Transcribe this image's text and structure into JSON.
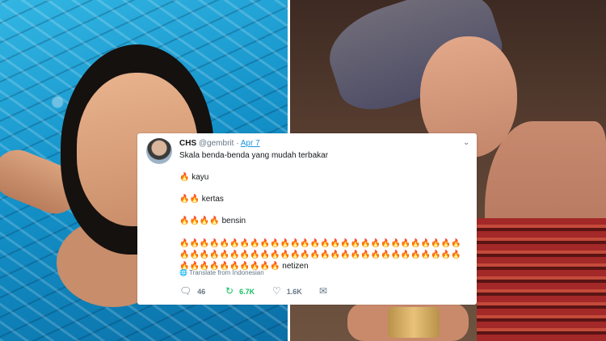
{
  "tweet": {
    "display_name": "CHS",
    "handle": "@gembrit",
    "separator": "·",
    "date": "Apr 7",
    "menu_icon": "chevron-down",
    "intro": "Skala benda-benda yang mudah terbakar",
    "lines": [
      {
        "emoji": "🔥",
        "label": "kayu"
      },
      {
        "emoji": "🔥🔥",
        "label": "kertas"
      },
      {
        "emoji": "🔥🔥🔥🔥",
        "label": "bensin"
      }
    ],
    "last_emoji": "🔥🔥🔥🔥🔥🔥🔥🔥🔥🔥🔥🔥🔥🔥🔥🔥🔥🔥🔥🔥🔥🔥🔥🔥🔥🔥🔥🔥🔥🔥🔥🔥🔥🔥🔥🔥🔥🔥🔥🔥🔥🔥🔥🔥🔥🔥🔥🔥🔥🔥🔥🔥🔥🔥🔥🔥🔥🔥🔥🔥🔥🔥🔥🔥🔥🔥",
    "last_label": "netizen",
    "translate": "Translate from Indonesian",
    "globe_icon": "globe",
    "reply_count": "46",
    "retweet_count": "6.7K",
    "like_count": "1.6K",
    "retweet_color": "#17bf63"
  }
}
